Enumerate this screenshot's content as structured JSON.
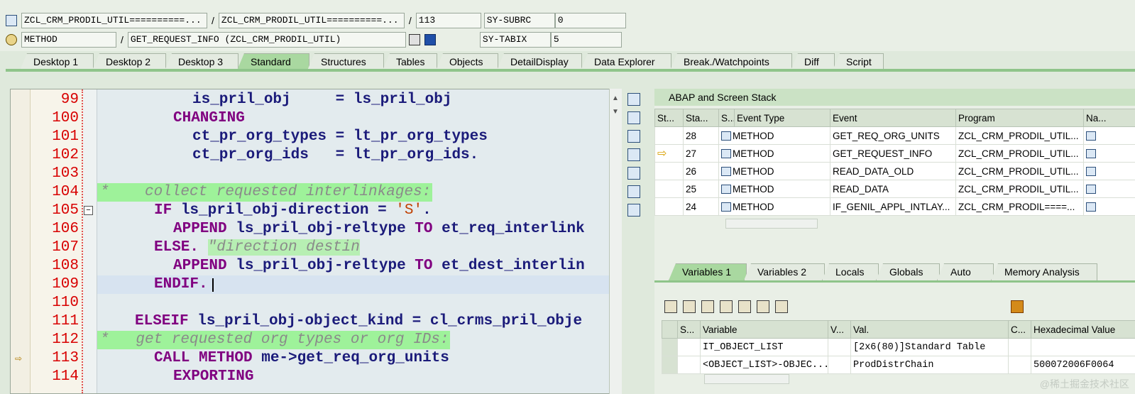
{
  "header": {
    "row1": {
      "field1": "ZCL_CRM_PRODIL_UTIL==========...",
      "field2": "ZCL_CRM_PRODIL_UTIL==========...",
      "line": "113",
      "sy_label": "SY-SUBRC",
      "sy_value": "0"
    },
    "row2": {
      "type": "METHOD",
      "method": "GET_REQUEST_INFO (ZCL_CRM_PRODIL_UTIL)",
      "sy_label": "SY-TABIX",
      "sy_value": "5"
    },
    "separator": "/"
  },
  "tabs": [
    "Desktop 1",
    "Desktop 2",
    "Desktop 3",
    "Standard",
    "Structures",
    "Tables",
    "Objects",
    "DetailDisplay",
    "Data Explorer",
    "Break./Watchpoints",
    "Diff",
    "Script"
  ],
  "active_tab": "Standard",
  "code": [
    {
      "no": "99"
    },
    {
      "no": "100"
    },
    {
      "no": "101"
    },
    {
      "no": "102"
    },
    {
      "no": "103"
    },
    {
      "no": "104"
    },
    {
      "no": "105"
    },
    {
      "no": "106"
    },
    {
      "no": "107"
    },
    {
      "no": "108"
    },
    {
      "no": "109"
    },
    {
      "no": "110"
    },
    {
      "no": "111"
    },
    {
      "no": "112"
    },
    {
      "no": "113"
    },
    {
      "no": "114"
    }
  ],
  "code_text": {
    "l99": "is_pril_obj     = ls_pril_obj",
    "l100": "CHANGING",
    "l101": "ct_pr_org_types = lt_pr_org_types",
    "l102": "ct_pr_org_ids   = lt_pr_org_ids.",
    "l104": "*    collect requested interlinkages:",
    "l105_a": "IF",
    "l105_b": " ls_pril_obj-direction = ",
    "l105_c": "'S'",
    "l105_d": ".",
    "l106_a": "APPEND",
    "l106_b": " ls_pril_obj-reltype ",
    "l106_c": "TO",
    "l106_d": " et_req_interlink",
    "l107_a": "ELSE.",
    "l107_b": "\"direction destin",
    "l108_a": "APPEND",
    "l108_b": " ls_pril_obj-reltype ",
    "l108_c": "TO",
    "l108_d": " et_dest_interlin",
    "l109": "ENDIF.",
    "l111_a": "ELSEIF",
    "l111_b": " ls_pril_obj-object_kind = cl_crms_pril_obje",
    "l112": "*   get requested org types or org IDs:",
    "l113_a": "CALL METHOD",
    "l113_b": " me->get_req_org_units",
    "l114": "EXPORTING"
  },
  "stack": {
    "title": "ABAP and Screen Stack",
    "columns": [
      "St...",
      "Sta...",
      "S...",
      "Event Type",
      "Event",
      "Program",
      "Na..."
    ],
    "rows": [
      {
        "level": "28",
        "type": "METHOD",
        "event": "GET_REQ_ORG_UNITS",
        "program": "ZCL_CRM_PRODIL_UTIL..."
      },
      {
        "level": "27",
        "type": "METHOD",
        "event": "GET_REQUEST_INFO",
        "program": "ZCL_CRM_PRODIL_UTIL..."
      },
      {
        "level": "26",
        "type": "METHOD",
        "event": "READ_DATA_OLD",
        "program": "ZCL_CRM_PRODIL_UTIL..."
      },
      {
        "level": "25",
        "type": "METHOD",
        "event": "READ_DATA",
        "program": "ZCL_CRM_PRODIL_UTIL..."
      },
      {
        "level": "24",
        "type": "METHOD",
        "event": "IF_GENIL_APPL_INTLAY...",
        "program": "ZCL_CRM_PRODIL====..."
      }
    ],
    "current_row": 1
  },
  "var_tabs": [
    "Variables 1",
    "Variables 2",
    "Locals",
    "Globals",
    "Auto",
    "Memory Analysis"
  ],
  "active_var_tab": "Variables 1",
  "variables": {
    "columns": [
      "S...",
      "Variable",
      "V...",
      "Val.",
      "C...",
      "Hexadecimal Value"
    ],
    "rows": [
      {
        "name": "IT_OBJECT_LIST",
        "value": "[2x6(80)]Standard Table",
        "hex": ""
      },
      {
        "name": "<OBJECT_LIST>-OBJEC...",
        "value": "ProdDistrChain",
        "hex": "500072006F0064"
      }
    ]
  },
  "watermark": "@稀土掘金技术社区"
}
